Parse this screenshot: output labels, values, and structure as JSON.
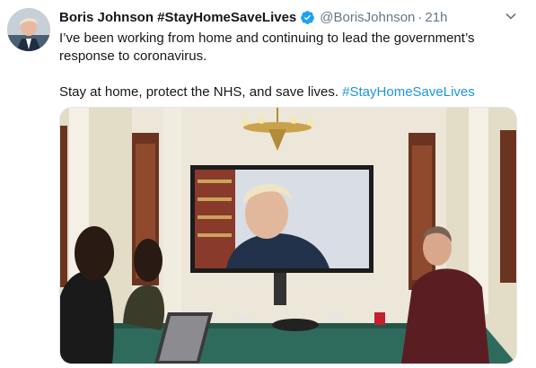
{
  "tweet": {
    "display_name": "Boris Johnson #StayHomeSaveLives",
    "verified_icon": "verified-badge-icon",
    "handle": "@BorisJohnson",
    "separator": "·",
    "timestamp": "21h",
    "line1": "I’ve been working from home and continuing to lead the government’s",
    "line2": "response to coronavirus.",
    "line3_prefix": "Stay at home, protect the NHS, and save lives.",
    "line3_hashtag": "#StayHomeSaveLives",
    "menu_icon": "chevron-down-icon",
    "hashtag_color": "#1b95e0",
    "verified_color": "#1da1f2"
  }
}
